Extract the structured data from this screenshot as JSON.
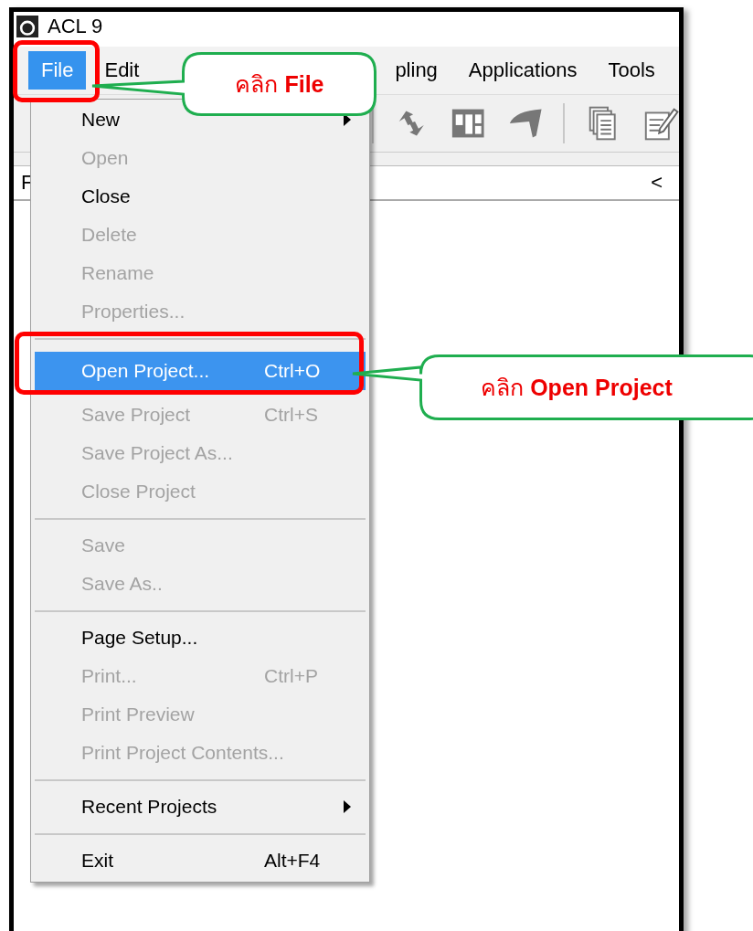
{
  "window": {
    "title": "ACL 9"
  },
  "menu_bar": [
    {
      "label": "File",
      "selected": true
    },
    {
      "label": "Edit",
      "selected": false
    },
    {
      "label": "pling",
      "selected": false
    },
    {
      "label": "Applications",
      "selected": false
    },
    {
      "label": "Tools",
      "selected": false
    }
  ],
  "pane": {
    "title": "F",
    "collapse": "<"
  },
  "file_menu": [
    {
      "kind": "item",
      "label": "New",
      "disabled": false,
      "selected": false,
      "submenu": true
    },
    {
      "kind": "item",
      "label": "Open",
      "disabled": true,
      "selected": false,
      "submenu": false
    },
    {
      "kind": "item",
      "label": "Close",
      "disabled": false,
      "selected": false,
      "submenu": false
    },
    {
      "kind": "item",
      "label": "Delete",
      "disabled": true,
      "selected": false,
      "submenu": false
    },
    {
      "kind": "item",
      "label": "Rename",
      "disabled": true,
      "selected": false,
      "submenu": false
    },
    {
      "kind": "item",
      "label": "Properties...",
      "disabled": true,
      "selected": false,
      "submenu": false
    },
    {
      "kind": "separator"
    },
    {
      "kind": "item",
      "label": "Open Project...",
      "shortcut": "Ctrl+O",
      "disabled": false,
      "selected": true,
      "submenu": false
    },
    {
      "kind": "item",
      "label": "Save Project",
      "shortcut": "Ctrl+S",
      "disabled": true,
      "selected": false,
      "submenu": false
    },
    {
      "kind": "item",
      "label": "Save Project As...",
      "disabled": true,
      "selected": false,
      "submenu": false
    },
    {
      "kind": "item",
      "label": "Close Project",
      "disabled": true,
      "selected": false,
      "submenu": false
    },
    {
      "kind": "separator"
    },
    {
      "kind": "item",
      "label": "Save",
      "disabled": true,
      "selected": false,
      "submenu": false
    },
    {
      "kind": "item",
      "label": "Save As..",
      "disabled": true,
      "selected": false,
      "submenu": false
    },
    {
      "kind": "separator"
    },
    {
      "kind": "item",
      "label": "Page Setup...",
      "disabled": false,
      "selected": false,
      "submenu": false
    },
    {
      "kind": "item",
      "label": "Print...",
      "shortcut": "Ctrl+P",
      "disabled": true,
      "selected": false,
      "submenu": false
    },
    {
      "kind": "item",
      "label": "Print Preview",
      "disabled": true,
      "selected": false,
      "submenu": false
    },
    {
      "kind": "item",
      "label": "Print Project Contents...",
      "disabled": true,
      "selected": false,
      "submenu": false
    },
    {
      "kind": "separator"
    },
    {
      "kind": "item",
      "label": "Recent Projects",
      "disabled": false,
      "selected": false,
      "submenu": true
    },
    {
      "kind": "separator"
    },
    {
      "kind": "item",
      "label": "Exit",
      "shortcut": "Alt+F4",
      "disabled": false,
      "selected": false,
      "submenu": false
    }
  ],
  "callouts": [
    {
      "text": "คลิก **File**"
    },
    {
      "text": "คลิก **Open Project**"
    }
  ]
}
